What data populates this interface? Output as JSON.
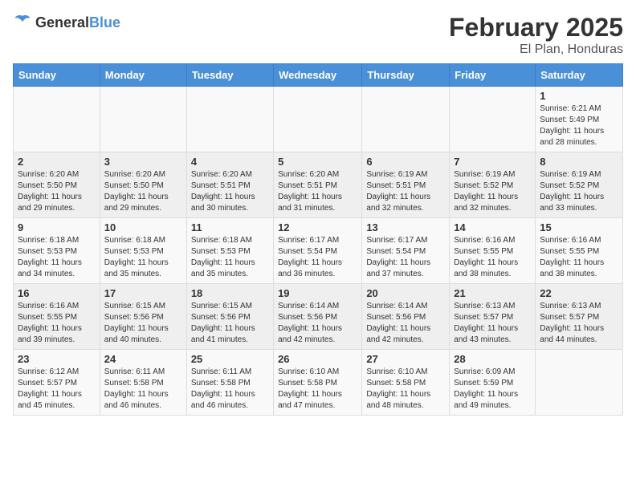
{
  "header": {
    "logo_general": "General",
    "logo_blue": "Blue",
    "title": "February 2025",
    "subtitle": "El Plan, Honduras"
  },
  "weekdays": [
    "Sunday",
    "Monday",
    "Tuesday",
    "Wednesday",
    "Thursday",
    "Friday",
    "Saturday"
  ],
  "weeks": [
    [
      {
        "day": "",
        "info": ""
      },
      {
        "day": "",
        "info": ""
      },
      {
        "day": "",
        "info": ""
      },
      {
        "day": "",
        "info": ""
      },
      {
        "day": "",
        "info": ""
      },
      {
        "day": "",
        "info": ""
      },
      {
        "day": "1",
        "info": "Sunrise: 6:21 AM\nSunset: 5:49 PM\nDaylight: 11 hours and 28 minutes."
      }
    ],
    [
      {
        "day": "2",
        "info": "Sunrise: 6:20 AM\nSunset: 5:50 PM\nDaylight: 11 hours and 29 minutes."
      },
      {
        "day": "3",
        "info": "Sunrise: 6:20 AM\nSunset: 5:50 PM\nDaylight: 11 hours and 29 minutes."
      },
      {
        "day": "4",
        "info": "Sunrise: 6:20 AM\nSunset: 5:51 PM\nDaylight: 11 hours and 30 minutes."
      },
      {
        "day": "5",
        "info": "Sunrise: 6:20 AM\nSunset: 5:51 PM\nDaylight: 11 hours and 31 minutes."
      },
      {
        "day": "6",
        "info": "Sunrise: 6:19 AM\nSunset: 5:51 PM\nDaylight: 11 hours and 32 minutes."
      },
      {
        "day": "7",
        "info": "Sunrise: 6:19 AM\nSunset: 5:52 PM\nDaylight: 11 hours and 32 minutes."
      },
      {
        "day": "8",
        "info": "Sunrise: 6:19 AM\nSunset: 5:52 PM\nDaylight: 11 hours and 33 minutes."
      }
    ],
    [
      {
        "day": "9",
        "info": "Sunrise: 6:18 AM\nSunset: 5:53 PM\nDaylight: 11 hours and 34 minutes."
      },
      {
        "day": "10",
        "info": "Sunrise: 6:18 AM\nSunset: 5:53 PM\nDaylight: 11 hours and 35 minutes."
      },
      {
        "day": "11",
        "info": "Sunrise: 6:18 AM\nSunset: 5:53 PM\nDaylight: 11 hours and 35 minutes."
      },
      {
        "day": "12",
        "info": "Sunrise: 6:17 AM\nSunset: 5:54 PM\nDaylight: 11 hours and 36 minutes."
      },
      {
        "day": "13",
        "info": "Sunrise: 6:17 AM\nSunset: 5:54 PM\nDaylight: 11 hours and 37 minutes."
      },
      {
        "day": "14",
        "info": "Sunrise: 6:16 AM\nSunset: 5:55 PM\nDaylight: 11 hours and 38 minutes."
      },
      {
        "day": "15",
        "info": "Sunrise: 6:16 AM\nSunset: 5:55 PM\nDaylight: 11 hours and 38 minutes."
      }
    ],
    [
      {
        "day": "16",
        "info": "Sunrise: 6:16 AM\nSunset: 5:55 PM\nDaylight: 11 hours and 39 minutes."
      },
      {
        "day": "17",
        "info": "Sunrise: 6:15 AM\nSunset: 5:56 PM\nDaylight: 11 hours and 40 minutes."
      },
      {
        "day": "18",
        "info": "Sunrise: 6:15 AM\nSunset: 5:56 PM\nDaylight: 11 hours and 41 minutes."
      },
      {
        "day": "19",
        "info": "Sunrise: 6:14 AM\nSunset: 5:56 PM\nDaylight: 11 hours and 42 minutes."
      },
      {
        "day": "20",
        "info": "Sunrise: 6:14 AM\nSunset: 5:56 PM\nDaylight: 11 hours and 42 minutes."
      },
      {
        "day": "21",
        "info": "Sunrise: 6:13 AM\nSunset: 5:57 PM\nDaylight: 11 hours and 43 minutes."
      },
      {
        "day": "22",
        "info": "Sunrise: 6:13 AM\nSunset: 5:57 PM\nDaylight: 11 hours and 44 minutes."
      }
    ],
    [
      {
        "day": "23",
        "info": "Sunrise: 6:12 AM\nSunset: 5:57 PM\nDaylight: 11 hours and 45 minutes."
      },
      {
        "day": "24",
        "info": "Sunrise: 6:11 AM\nSunset: 5:58 PM\nDaylight: 11 hours and 46 minutes."
      },
      {
        "day": "25",
        "info": "Sunrise: 6:11 AM\nSunset: 5:58 PM\nDaylight: 11 hours and 46 minutes."
      },
      {
        "day": "26",
        "info": "Sunrise: 6:10 AM\nSunset: 5:58 PM\nDaylight: 11 hours and 47 minutes."
      },
      {
        "day": "27",
        "info": "Sunrise: 6:10 AM\nSunset: 5:58 PM\nDaylight: 11 hours and 48 minutes."
      },
      {
        "day": "28",
        "info": "Sunrise: 6:09 AM\nSunset: 5:59 PM\nDaylight: 11 hours and 49 minutes."
      },
      {
        "day": "",
        "info": ""
      }
    ]
  ]
}
